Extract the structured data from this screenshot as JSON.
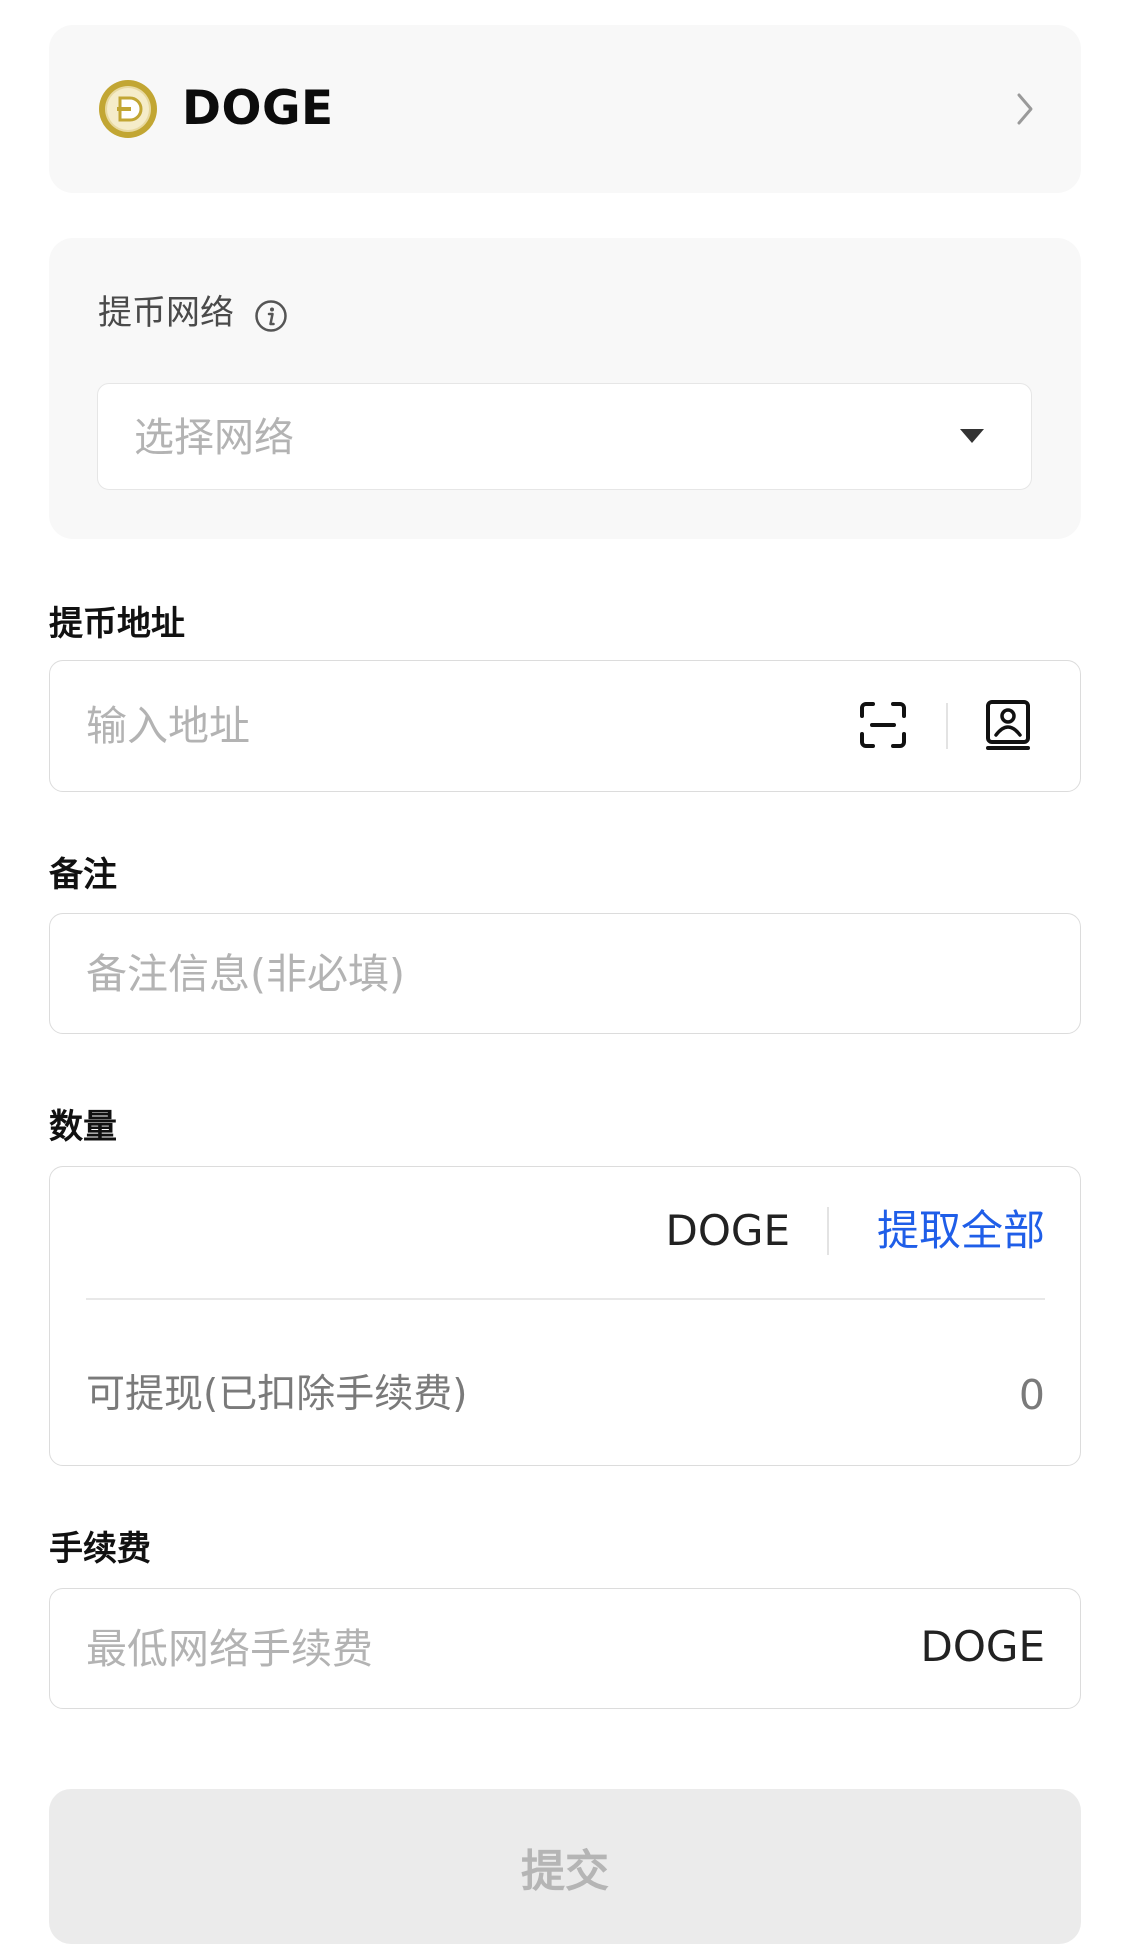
{
  "coin": {
    "symbol": "DOGE",
    "logo_icon": "dogecoin-logo-icon",
    "chevron_icon": "chevron-right-icon"
  },
  "network": {
    "label": "提币网络",
    "info_icon": "info-icon",
    "select_placeholder": "选择网络",
    "dropdown_icon": "caret-down-icon"
  },
  "address": {
    "label": "提币地址",
    "placeholder": "输入地址",
    "scan_icon": "scan-icon",
    "address_book_icon": "address-book-icon"
  },
  "memo": {
    "label": "备注",
    "placeholder": "备注信息(非必填)"
  },
  "amount": {
    "label": "数量",
    "unit": "DOGE",
    "max_link": "提取全部",
    "available_label": "可提现(已扣除手续费)",
    "available_value": "0"
  },
  "fee": {
    "label": "手续费",
    "placeholder": "最低网络手续费",
    "unit": "DOGE"
  },
  "submit": {
    "label": "提交"
  },
  "colors": {
    "accent": "#1f5ee8",
    "card_bg": "#f8f8f8",
    "placeholder": "#b3b3b3",
    "disabled_button": "#ebebeb",
    "doge_gold": "#c2a633"
  }
}
